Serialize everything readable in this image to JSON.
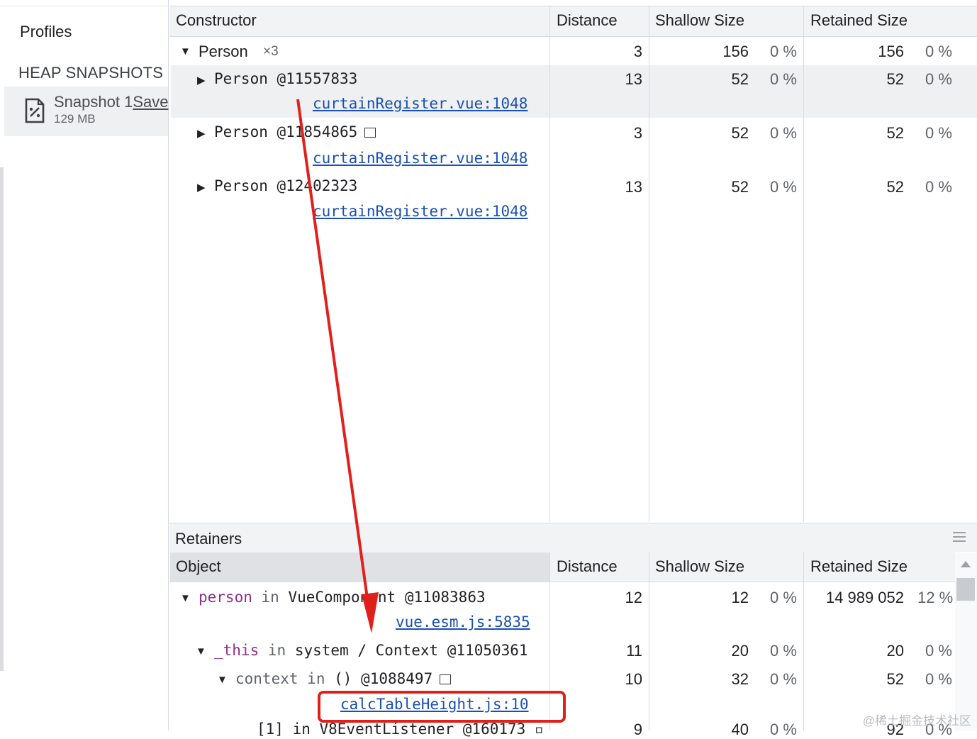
{
  "sidebar": {
    "title": "Profiles",
    "section_header": "HEAP SNAPSHOTS",
    "snapshot": {
      "name": "Snapshot 1",
      "save_label": "Save",
      "size": "129 MB",
      "icon": "snapshot-file-icon"
    }
  },
  "top_table": {
    "columns": [
      "Constructor",
      "Distance",
      "Shallow Size",
      "Retained Size"
    ],
    "group": {
      "name": "Person",
      "count": "×3",
      "distance": "3",
      "shallow": "156",
      "shallow_pct": "0 %",
      "retained": "156",
      "retained_pct": "0 %"
    },
    "rows": [
      {
        "label": "Person @11557833",
        "link": "curtainRegister.vue:1048",
        "distance": "13",
        "shallow": "52",
        "shallow_pct": "0 %",
        "retained": "52",
        "retained_pct": "0 %",
        "selected": true
      },
      {
        "label": "Person @11854865",
        "link": "curtainRegister.vue:1048",
        "distance": "3",
        "shallow": "52",
        "shallow_pct": "0 %",
        "retained": "52",
        "retained_pct": "0 %"
      },
      {
        "label": "Person @12402323",
        "link": "curtainRegister.vue:1048",
        "distance": "13",
        "shallow": "52",
        "shallow_pct": "0 %",
        "retained": "52",
        "retained_pct": "0 %"
      }
    ]
  },
  "retainers": {
    "title": "Retainers",
    "columns": [
      "Object",
      "Distance",
      "Shallow Size",
      "Retained Size"
    ],
    "rows": [
      {
        "prop": "person",
        "in_word": "in",
        "obj": "VueComponent @11083863",
        "link": "vue.esm.js:5835",
        "distance": "12",
        "shallow": "12",
        "shallow_pct": "0 %",
        "retained": "14 989 052",
        "retained_pct": "12 %"
      },
      {
        "prop": "_this",
        "in_word": "in",
        "obj": "system / Context @11050361",
        "distance": "11",
        "shallow": "20",
        "shallow_pct": "0 %",
        "retained": "20",
        "retained_pct": "0 %"
      },
      {
        "prop": "context",
        "in_word": "in",
        "obj": "() @1088497",
        "link": "calcTableHeight.js:10",
        "distance": "10",
        "shallow": "32",
        "shallow_pct": "0 %",
        "retained": "52",
        "retained_pct": "0 %"
      },
      {
        "partial": "[1] in V8EventListener @160173 ▫",
        "distance": "9",
        "shallow": "40",
        "shallow_pct": "0 %",
        "retained": "92",
        "retained_pct": "0 %"
      }
    ]
  },
  "watermark": "@稀土掘金技术社区",
  "colors": {
    "annotation": "#e0201a",
    "link": "#1a4fb5",
    "property": "#8b2f8c"
  }
}
